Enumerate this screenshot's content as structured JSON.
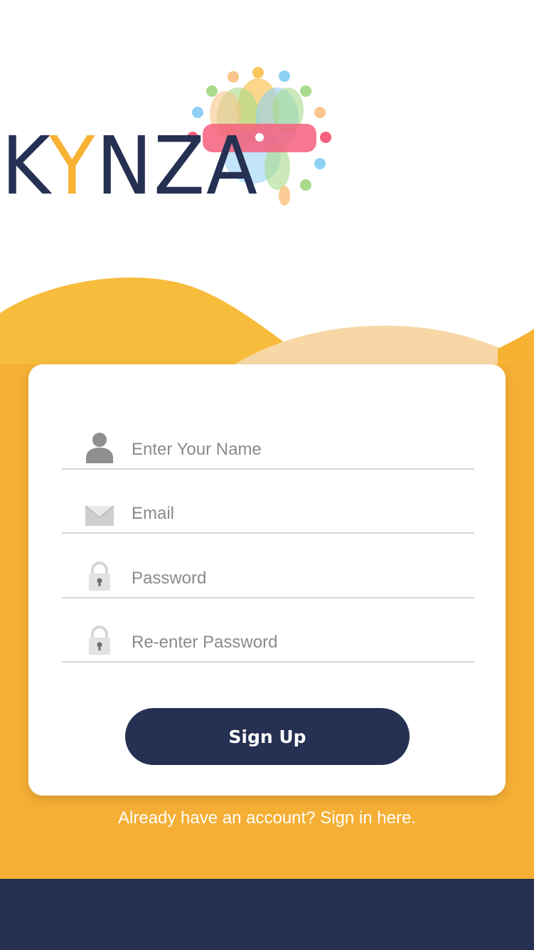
{
  "brand": {
    "logo_text": "KYNZA",
    "primary_color": "#253052",
    "accent_color": "#F7B133"
  },
  "form": {
    "name_placeholder": "Enter Your Name",
    "email_placeholder": "Email",
    "password_placeholder": "Password",
    "confirm_password_placeholder": "Re-enter Password",
    "submit_label": "Sign Up"
  },
  "footer": {
    "signin_prompt": "Already have an account? Sign in here."
  },
  "icons": {
    "name": "user-icon",
    "email": "envelope-icon",
    "password": "lock-icon",
    "confirm_password": "lock-icon"
  }
}
